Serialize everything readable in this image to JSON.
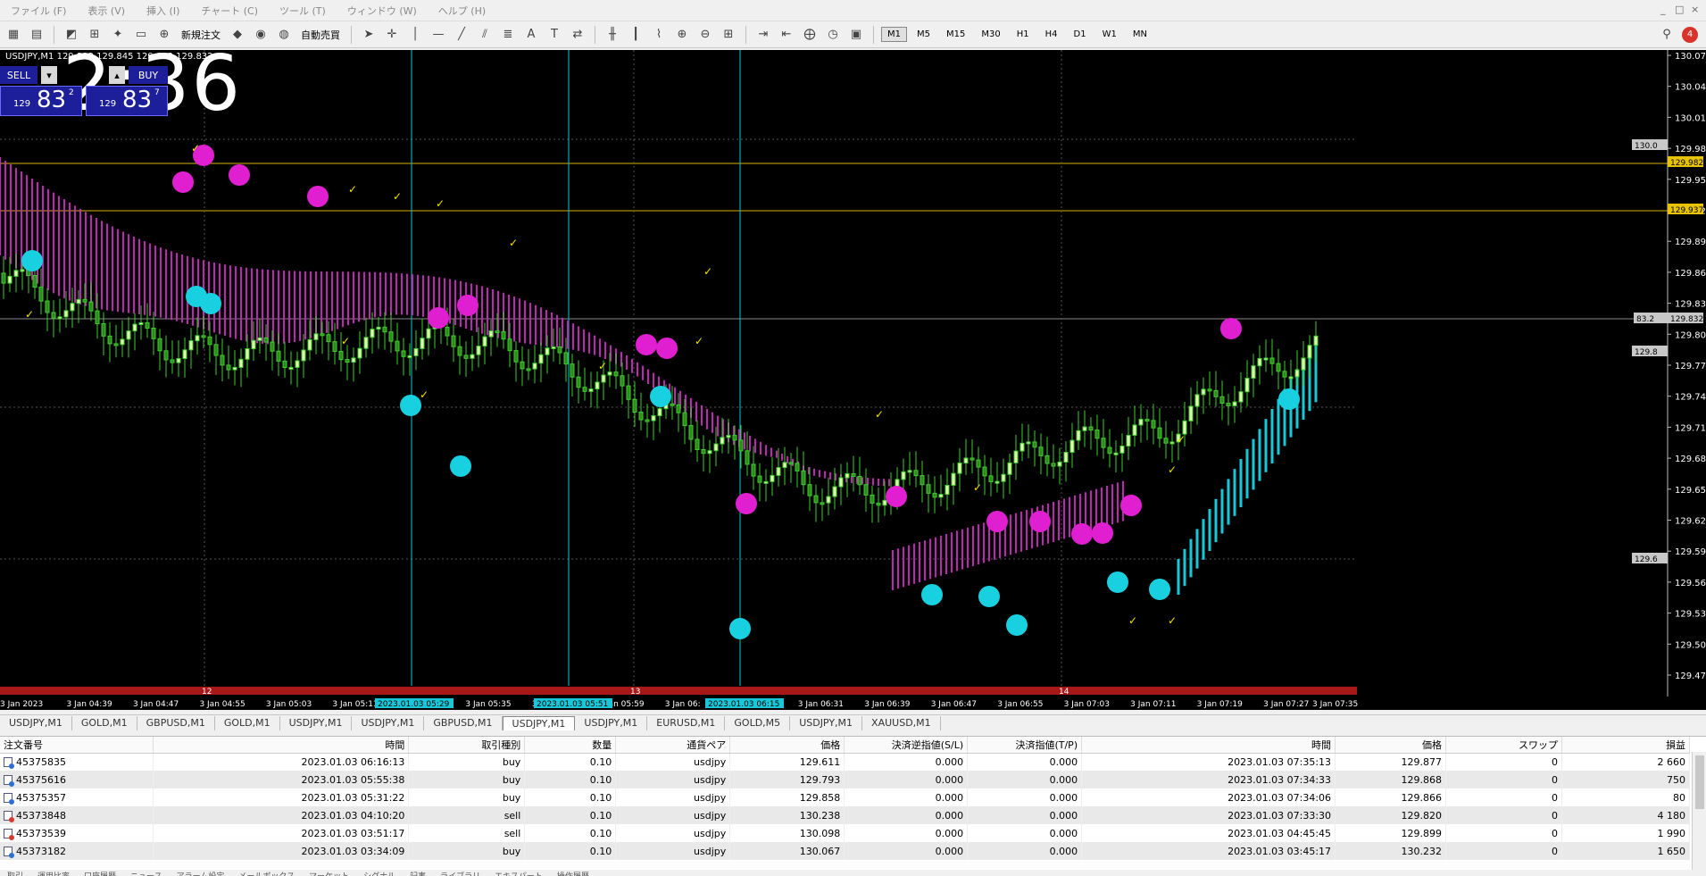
{
  "menu": {
    "items": [
      "ファイル (F)",
      "表示 (V)",
      "挿入 (I)",
      "チャート (C)",
      "ツール (T)",
      "ウィンドウ (W)",
      "ヘルプ (H)"
    ],
    "win_controls": [
      "_",
      "□",
      "×"
    ]
  },
  "toolbar": {
    "new_order_label": "新規注文",
    "auto_trade_label": "自動売買",
    "timeframes": [
      "M1",
      "M5",
      "M15",
      "M30",
      "H1",
      "H4",
      "D1",
      "W1",
      "MN"
    ],
    "active_timeframe": "M1",
    "notification_count": "4"
  },
  "chart": {
    "title": "USDJPY,M1 129.832 129.845 129.812 129.832",
    "clock": "2:36",
    "trade": {
      "sell_label": "SELL",
      "buy_label": "BUY",
      "sell_prefix": "129",
      "sell_big": "83",
      "sell_sup": "2",
      "buy_prefix": "129",
      "buy_big": "83",
      "buy_sup": "7"
    },
    "price_axis": [
      "130.075",
      "130.045",
      "130.015",
      "129.985",
      "129.955",
      "129.925",
      "129.895",
      "129.865",
      "129.835",
      "129.805",
      "129.775",
      "129.745",
      "129.715",
      "129.685",
      "129.655",
      "129.625",
      "129.595",
      "129.565",
      "129.535",
      "129.505",
      "129.475"
    ],
    "price_tags": [
      {
        "label": "130.0",
        "color": "#c8c8c8"
      },
      {
        "label": "129.982",
        "color": "#e8c400"
      },
      {
        "label": "129.937",
        "color": "#e8c400"
      },
      {
        "label": "83.2",
        "color": "#c8c8c8"
      },
      {
        "label": "129.832",
        "color": "#c8c8c8"
      },
      {
        "label": "129.8",
        "color": "#c8c8c8"
      },
      {
        "label": "129.6",
        "color": "#c8c8c8"
      }
    ],
    "time_axis": [
      "3 Jan 2023",
      "3 Jan 04:39",
      "3 Jan 04:47",
      "3 Jan 04:55",
      "3 Jan 05:03",
      "3 Jan 05:11",
      "3 Jan 05:",
      "3 Jan 05:35",
      "3 Jan",
      "3 Jan 05:59",
      "3 Jan 06:",
      "3 Jan 06:23",
      "3 Jan 06:31",
      "3 Jan 06:39",
      "3 Jan 06:47",
      "3 Jan 06:55",
      "3 Jan 07:03",
      "3 Jan 07:11",
      "3 Jan 07:19",
      "3 Jan 07:27",
      "3 Jan 07:35"
    ],
    "time_highlights": [
      "2023.01.03 05:29",
      "2023.01.03 05:51",
      "2023.01.03 06:15"
    ],
    "session_labels": [
      "12",
      "13",
      "14"
    ]
  },
  "symbol_tabs": [
    "USDJPY,M1",
    "GOLD,M1",
    "GBPUSD,M1",
    "GOLD,M1",
    "USDJPY,M1",
    "USDJPY,M1",
    "GBPUSD,M1",
    "USDJPY,M1",
    "USDJPY,M1",
    "EURUSD,M1",
    "GOLD,M5",
    "USDJPY,M1",
    "XAUUSD,M1"
  ],
  "active_symbol_tab_index": 7,
  "history": {
    "columns": [
      "注文番号",
      "時間",
      "取引種別",
      "数量",
      "通貨ペア",
      "価格",
      "決済逆指値(S/L)",
      "決済指値(T/P)",
      "時間",
      "価格",
      "スワップ",
      "損益"
    ],
    "rows": [
      [
        "45375835",
        "2023.01.03 06:16:13",
        "buy",
        "0.10",
        "usdjpy",
        "129.611",
        "0.000",
        "0.000",
        "2023.01.03 07:35:13",
        "129.877",
        "0",
        "2 660"
      ],
      [
        "45375616",
        "2023.01.03 05:55:38",
        "buy",
        "0.10",
        "usdjpy",
        "129.793",
        "0.000",
        "0.000",
        "2023.01.03 07:34:33",
        "129.868",
        "0",
        "750"
      ],
      [
        "45375357",
        "2023.01.03 05:31:22",
        "buy",
        "0.10",
        "usdjpy",
        "129.858",
        "0.000",
        "0.000",
        "2023.01.03 07:34:06",
        "129.866",
        "0",
        "80"
      ],
      [
        "45373848",
        "2023.01.03 04:10:20",
        "sell",
        "0.10",
        "usdjpy",
        "130.238",
        "0.000",
        "0.000",
        "2023.01.03 07:33:30",
        "129.820",
        "0",
        "4 180"
      ],
      [
        "45373539",
        "2023.01.03 03:51:17",
        "sell",
        "0.10",
        "usdjpy",
        "130.098",
        "0.000",
        "0.000",
        "2023.01.03 04:45:45",
        "129.899",
        "0",
        "1 990"
      ],
      [
        "45373182",
        "2023.01.03 03:34:09",
        "buy",
        "0.10",
        "usdjpy",
        "130.067",
        "0.000",
        "0.000",
        "2023.01.03 03:45:17",
        "130.232",
        "0",
        "1 650"
      ]
    ]
  },
  "bottom_tabs": [
    "取引",
    "運用比率",
    "口座履歴",
    "ニュース",
    "アラーム設定",
    "メールボックス",
    "マーケット",
    "シグナル",
    "記事",
    "ライブラリ",
    "エキスパート",
    "操作履歴"
  ]
}
